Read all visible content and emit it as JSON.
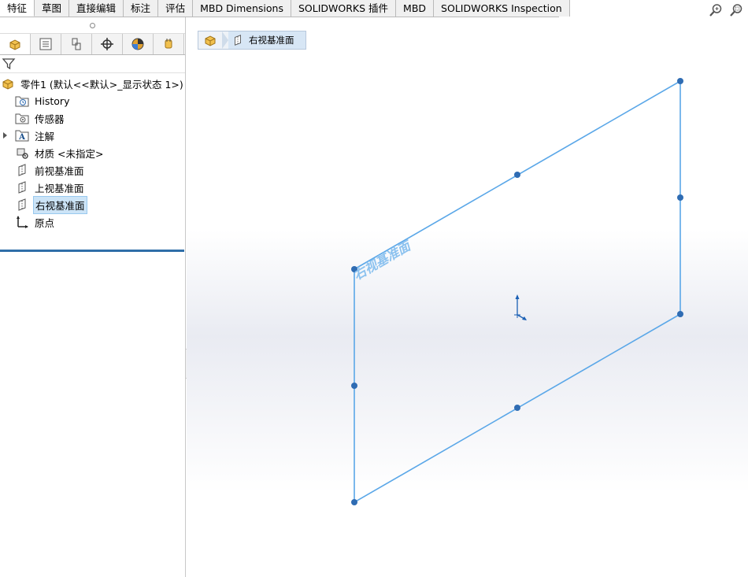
{
  "command_tabs": [
    {
      "label": "特征",
      "active": true
    },
    {
      "label": "草图",
      "active": false
    },
    {
      "label": "直接编辑",
      "active": false
    },
    {
      "label": "标注",
      "active": false
    },
    {
      "label": "评估",
      "active": false
    },
    {
      "label": "MBD Dimensions",
      "active": false
    },
    {
      "label": "SOLIDWORKS 插件",
      "active": false
    },
    {
      "label": "MBD",
      "active": false
    },
    {
      "label": "SOLIDWORKS Inspection",
      "active": false
    }
  ],
  "feature_tree": {
    "root": {
      "label": "零件1  (默认<<默认>_显示状态 1>)",
      "icon": "part-icon"
    },
    "items": [
      {
        "label": "History",
        "icon": "history-folder-icon",
        "expandable": false,
        "selected": false
      },
      {
        "label": "传感器",
        "icon": "sensor-folder-icon",
        "expandable": false,
        "selected": false
      },
      {
        "label": "注解",
        "icon": "annotation-icon",
        "expandable": true,
        "selected": false
      },
      {
        "label": "材质 <未指定>",
        "icon": "material-icon",
        "expandable": false,
        "selected": false
      },
      {
        "label": "前视基准面",
        "icon": "plane-icon",
        "expandable": false,
        "selected": false
      },
      {
        "label": "上视基准面",
        "icon": "plane-icon",
        "expandable": false,
        "selected": false
      },
      {
        "label": "右视基准面",
        "icon": "plane-icon",
        "expandable": false,
        "selected": true
      },
      {
        "label": "原点",
        "icon": "origin-icon",
        "expandable": false,
        "selected": false
      }
    ]
  },
  "breadcrumb": {
    "label": "右视基准面"
  },
  "viewport": {
    "plane_label": "右视基准面"
  },
  "colors": {
    "plane_line": "#5aa7e8",
    "handle": "#2f6cb3",
    "selection_bg": "#cce4f7",
    "rollback_bar": "#2f6ea8"
  }
}
